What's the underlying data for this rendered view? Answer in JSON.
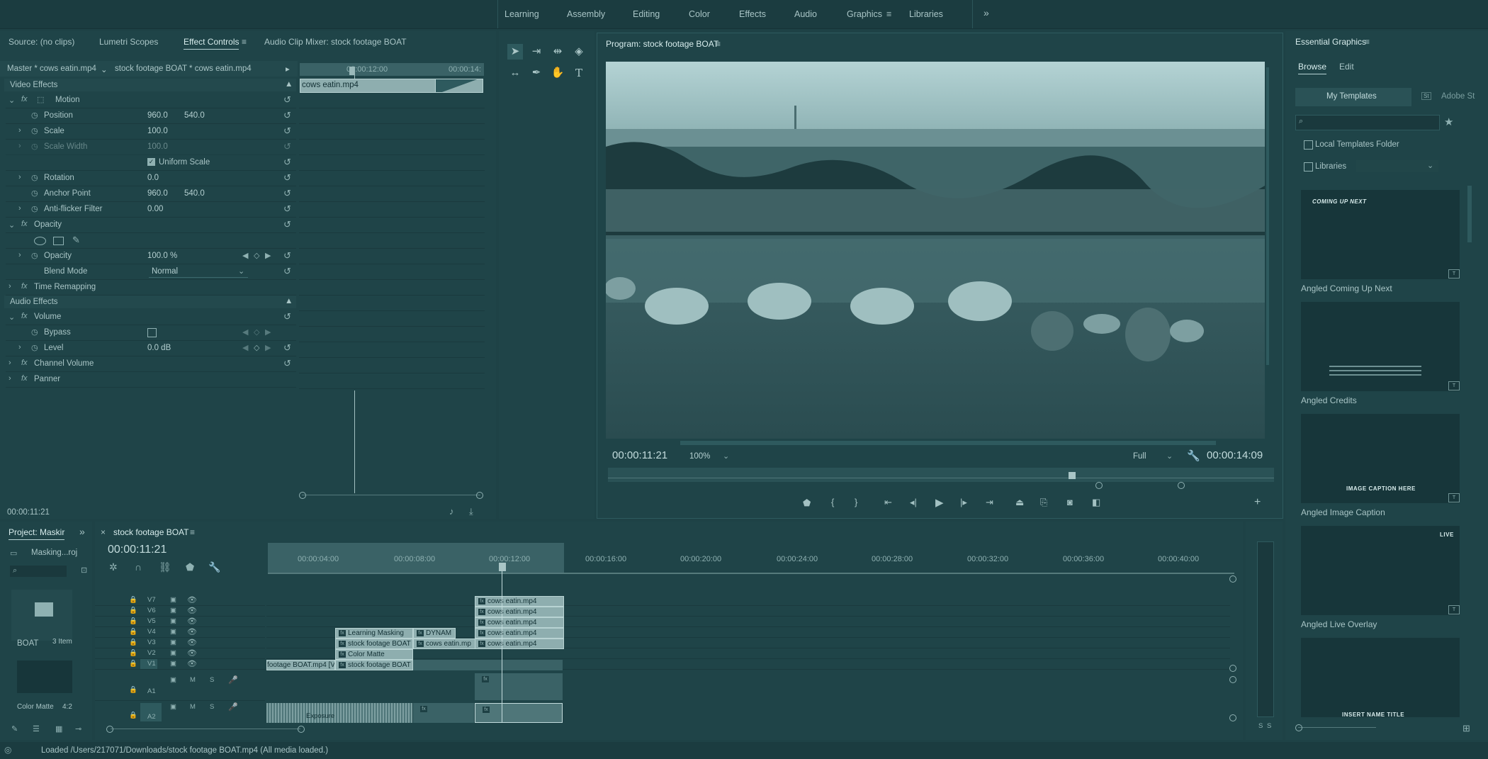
{
  "workspaces": [
    "Learning",
    "Assembly",
    "Editing",
    "Color",
    "Effects",
    "Audio",
    "Graphics",
    "Libraries"
  ],
  "source_panel": {
    "tabs": [
      "Source: (no clips)",
      "Lumetri Scopes",
      "Effect Controls",
      "Audio Clip Mixer: stock footage BOAT"
    ],
    "master_label": "Master * cows eatin.mp4",
    "clip_label": "stock footage BOAT * cows eatin.mp4",
    "ruler_start": "00:00:12:00",
    "ruler_end": "00:00:14:",
    "clip_name": "cows eatin.mp4",
    "timecode": "00:00:11:21",
    "video_effects": "Video Effects",
    "audio_effects": "Audio Effects",
    "motion": "Motion",
    "position": {
      "label": "Position",
      "x": "960.0",
      "y": "540.0"
    },
    "scale": {
      "label": "Scale",
      "value": "100.0"
    },
    "scale_width": {
      "label": "Scale Width",
      "value": "100.0"
    },
    "uniform_scale": "Uniform Scale",
    "rotation": {
      "label": "Rotation",
      "value": "0.0"
    },
    "anchor_point": {
      "label": "Anchor Point",
      "x": "960.0",
      "y": "540.0"
    },
    "anti_flicker": {
      "label": "Anti-flicker Filter",
      "value": "0.00"
    },
    "opacity_group": "Opacity",
    "opacity": {
      "label": "Opacity",
      "value": "100.0 %"
    },
    "blend_mode": {
      "label": "Blend Mode",
      "value": "Normal"
    },
    "time_remapping": "Time Remapping",
    "volume": "Volume",
    "bypass": "Bypass",
    "level": {
      "label": "Level",
      "value": "0.0 dB"
    },
    "channel_volume": "Channel Volume",
    "panner": "Panner"
  },
  "program": {
    "title": "Program: stock footage BOAT",
    "timecode": "00:00:11:21",
    "zoom": "100%",
    "resolution": "Full",
    "duration": "00:00:14:09"
  },
  "essential_graphics": {
    "title": "Essential Graphics",
    "tabs": [
      "Browse",
      "Edit"
    ],
    "my_templates": "My Templates",
    "adobe_stock": "Adobe St",
    "local_templates": "Local Templates Folder",
    "libraries": "Libraries",
    "templates": [
      {
        "name": "Angled Coming Up Next",
        "overlay": "COMING UP NEXT"
      },
      {
        "name": "Angled Credits",
        "overlay": ""
      },
      {
        "name": "Angled Image Caption",
        "overlay": "IMAGE CAPTION HERE"
      },
      {
        "name": "Angled Live Overlay",
        "overlay": "LIVE"
      },
      {
        "name": "",
        "overlay": "INSERT NAME TITLE"
      }
    ]
  },
  "project": {
    "title": "Project: Maskir",
    "file": "Masking...roj",
    "bin_name": "BOAT",
    "bin_count": "3 Item",
    "matte_name": "Color Matte",
    "matte_dur": "4:2"
  },
  "timeline": {
    "title": "stock footage BOAT",
    "timecode": "00:00:11:21",
    "ruler": [
      "00:00:04:00",
      "00:00:08:00",
      "00:00:12:00",
      "00:00:16:00",
      "00:00:20:00",
      "00:00:24:00",
      "00:00:28:00",
      "00:00:32:00",
      "00:00:36:00",
      "00:00:40:00"
    ],
    "video_tracks": [
      "V7",
      "V6",
      "V5",
      "V4",
      "V3",
      "V2",
      "V1"
    ],
    "audio_tracks": [
      "A1",
      "A2"
    ],
    "clips": {
      "c_v7": "cows eatin.mp4",
      "c_v6": "cows eatin.mp4",
      "c_v5": "cows eatin.mp4",
      "c_v4": "cows eatin.mp4",
      "c_v3": "cows eatin.mp4",
      "learning": "Learning Masking",
      "dynam": "DYNAM",
      "stock_v3": "stock footage BOAT",
      "cows_v3": "cows eatin.mp",
      "color_matte": "Color Matte",
      "boat_v1a": "footage BOAT.mp4 [V]",
      "boat_v1b": "stock footage BOAT",
      "exposure": "Exposure"
    },
    "meter_labels": [
      "S",
      "S"
    ]
  },
  "status_bar": "Loaded /Users/217071/Downloads/stock footage BOAT.mp4 (All media loaded.)"
}
